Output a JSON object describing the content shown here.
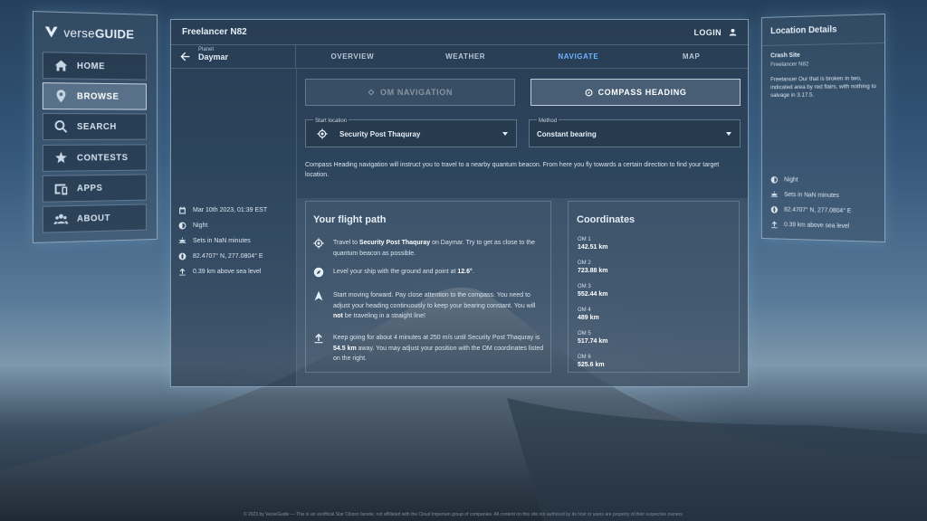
{
  "brand": {
    "name_light": "verse",
    "name_bold": "GUIDE"
  },
  "nav": {
    "items": [
      {
        "label": "HOME",
        "icon": "home-icon"
      },
      {
        "label": "BROWSE",
        "icon": "location-pin-icon",
        "active": true
      },
      {
        "label": "SEARCH",
        "icon": "search-icon"
      },
      {
        "label": "CONTESTS",
        "icon": "trophy-star-icon"
      },
      {
        "label": "APPS",
        "icon": "devices-icon"
      },
      {
        "label": "ABOUT",
        "icon": "group-icon"
      }
    ]
  },
  "header": {
    "title": "Freelancer N82",
    "login_label": "LOGIN"
  },
  "planet": {
    "label": "Planet",
    "value": "Daymar"
  },
  "tabs": [
    {
      "label": "OVERVIEW"
    },
    {
      "label": "WEATHER"
    },
    {
      "label": "NAVIGATE",
      "active": true
    },
    {
      "label": "MAP"
    }
  ],
  "buttons": {
    "om": "OM NAVIGATION",
    "compass": "COMPASS HEADING"
  },
  "start_location": {
    "label": "Start location",
    "value": "Security Post Thaquray"
  },
  "method": {
    "label": "Method",
    "value": "Constant bearing"
  },
  "description": "Compass Heading navigation will instruct you to travel to a nearby quantum beacon. From here you fly towards a certain direction to find your target location.",
  "left_info": {
    "date": "Mar 10th 2023, 01:39 EST",
    "time_of_day": "Night",
    "sets": "Sets in NaN minutes",
    "coords": "82.4707° N, 277.0804° E",
    "altitude": "0.39 km above sea level"
  },
  "flight": {
    "title": "Your flight path",
    "step1": {
      "pre": "Travel to ",
      "bold": "Security Post Thaquray",
      "post": " on Daymar. Try to get as close to the quantum beacon as possible."
    },
    "step2": {
      "pre": "Level your ship with the ground and point at ",
      "bold": "12.6°",
      "post": "."
    },
    "step3": {
      "pre": "Start moving forward. Pay close attention to the compass. You need to adjust your heading continuously to keep your bearing constant. You will ",
      "bold": "not",
      "post": " be traveling in a straight line!"
    },
    "step4": {
      "pre": "Keep going for about 4 minutes at 250 m/s until Security Post Thaquray is ",
      "bold": "54.5 km",
      "post": " away. You may adjust your position with the OM coordinates listed on the right."
    }
  },
  "coordinates": {
    "title": "Coordinates",
    "items": [
      {
        "label": "OM 1",
        "value": "142.51 km"
      },
      {
        "label": "OM 2",
        "value": "723.88 km"
      },
      {
        "label": "OM 3",
        "value": "552.44 km"
      },
      {
        "label": "OM 4",
        "value": "489 km"
      },
      {
        "label": "OM 5",
        "value": "517.74 km"
      },
      {
        "label": "OM 6",
        "value": "525.6 km"
      }
    ]
  },
  "location_details": {
    "header": "Location Details",
    "title": "Crash Site",
    "subtitle": "Freelancer N82",
    "description": "Freelancer Our that is broken in two, indicated area by red flairs, with nothing to salvage in 3.17.5.",
    "time_of_day": "Night",
    "sets": "Sets in NaN minutes",
    "coords": "82.4707° N, 277.0804° E",
    "altitude": "0.39 km above sea level"
  },
  "footer": "© 2023 by VerseGuide — This is an unofficial Star Citizen fansite, not affiliated with the Cloud Imperium group of companies. All content on this site not authored by its host or users are property of their respective owners.",
  "colors": {
    "accent": "#6fb2ff",
    "panel": "#2a3c50"
  }
}
